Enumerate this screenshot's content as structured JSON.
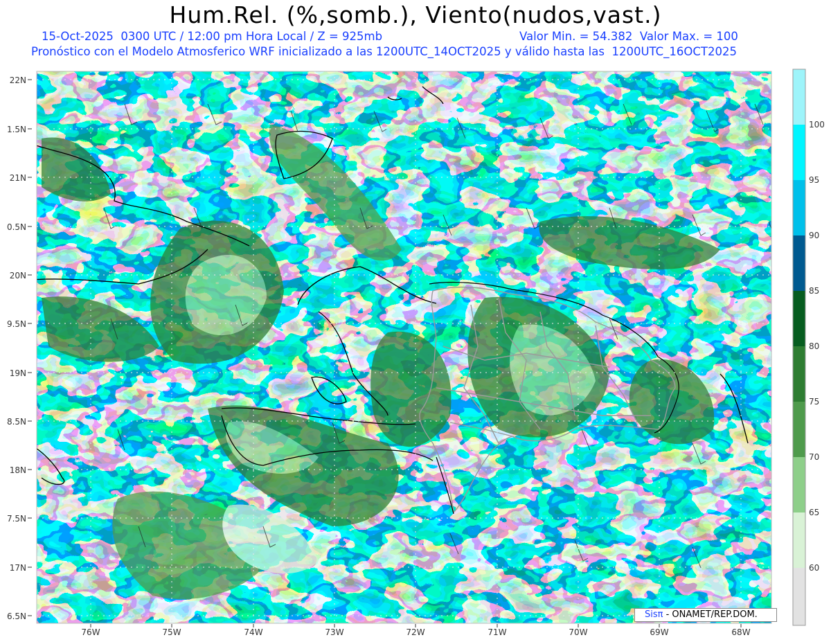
{
  "title": "Hum.Rel. (%,somb.), Viento(nudos,vast.)",
  "subtitle_line1": "15-Oct-2025  0300 UTC / 12:00 pm Hora Local / Z = 925mb",
  "subtitle_minmax": "Valor Min. = 54.382  Valor Max. = 100",
  "subtitle_line2": "Pronóstico con el Modelo Atmosferico WRF inicializado a las 1200UTC_14OCT2025 y válido hasta las  1200UTC_16OCT2025",
  "lat_labels": [
    "22N",
    "1.5N",
    "21N",
    "0.5N",
    "20N",
    "9.5N",
    "19N",
    "8.5N",
    "18N",
    "7.5N",
    "17N",
    "6.5N"
  ],
  "lon_labels": [
    "76W",
    "75W",
    "74W",
    "73W",
    "72W",
    "71W",
    "70W",
    "69W",
    "68W"
  ],
  "colorbar": {
    "labels": [
      "100",
      "95",
      "90",
      "85",
      "80",
      "75",
      "70",
      "65",
      "60"
    ],
    "colors": {
      "above_100": "#9ef4fa",
      "95_100": "#00f5ff",
      "90_95": "#00c0ea",
      "85_90": "#005a90",
      "80_85": "#075d20",
      "75_80": "#2e7d32",
      "70_75": "#4f9b4c",
      "65_70": "#8ecf8a",
      "60_65": "#d9f2d6",
      "below_60": "#e2e2e2"
    }
  },
  "credit": {
    "brand": "Sisπ",
    "text": "- ONAMET/REP.DOM."
  }
}
